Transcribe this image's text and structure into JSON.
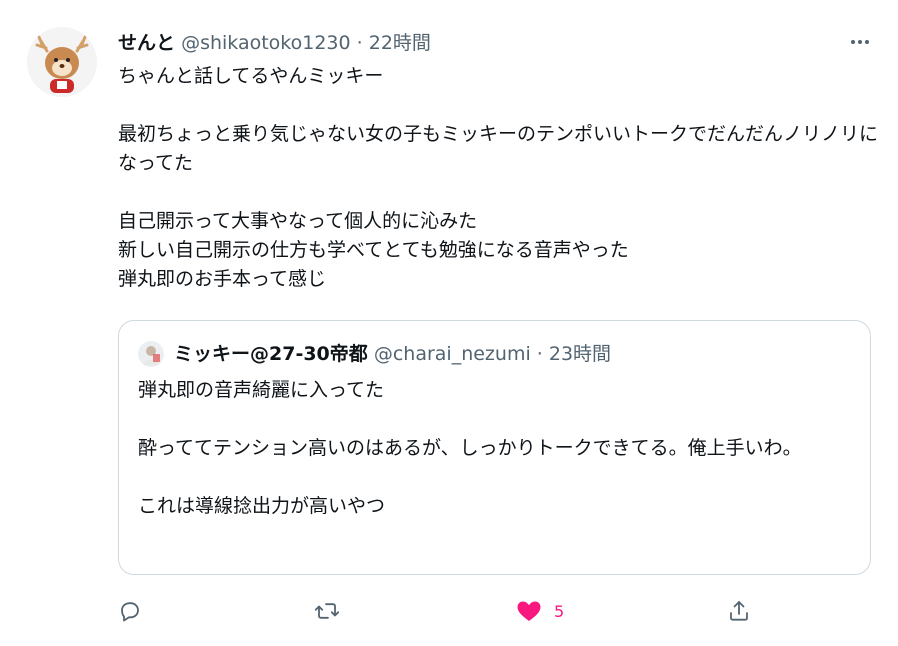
{
  "tweet": {
    "author_name": "せんと",
    "author_handle": "@shikaotoko1230",
    "separator": "·",
    "time": "22時間",
    "paragraphs": [
      "ちゃんと話してるやんミッキー",
      "最初ちょっと乗り気じゃない女の子もミッキーのテンポいいトークでだんだんノリノリになってた",
      "自己開示って大事やなって個人的に沁みた\n新しい自己開示の仕方も学べてとても勉強になる音声やった\n弾丸即のお手本って感じ"
    ]
  },
  "quote": {
    "author_name": "ミッキー@27-30帝都",
    "author_handle": "@charai_nezumi",
    "separator": "·",
    "time": "23時間",
    "paragraphs": [
      "弾丸即の音声綺麗に入ってた",
      "酔っててテンション高いのはあるが、しっかりトークできてる。俺上手いわ。",
      "これは導線捻出力が高いやつ"
    ]
  },
  "actions": {
    "reply_icon": "reply-icon",
    "retweet_icon": "retweet-icon",
    "like_icon": "heart-filled-icon",
    "like_count": "5",
    "share_icon": "share-icon"
  },
  "colors": {
    "text": "#0f1419",
    "muted": "#536471",
    "border": "#cfd9de",
    "like": "#f91880"
  }
}
